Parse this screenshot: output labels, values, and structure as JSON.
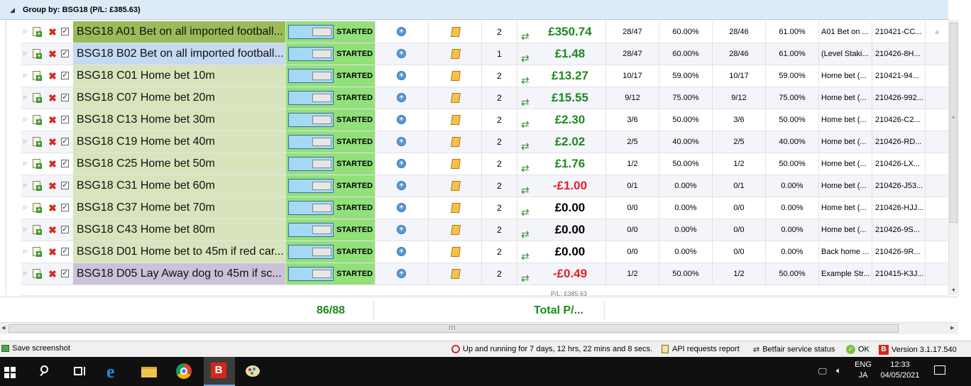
{
  "group": {
    "title": "Group by: BSG18 (P/L: £385.63)"
  },
  "rows": [
    {
      "name": "BSG18 A01 Bet on all imported football...",
      "status": "STARTED",
      "count": "2",
      "pl": "£350.74",
      "pl_class": "pos",
      "c1": "28/47",
      "c2": "60.00%",
      "c3": "28/46",
      "c4": "61.00%",
      "c5": "A01 Bet on ...",
      "c6": "210421-CC...",
      "c7": "a",
      "color": "top"
    },
    {
      "name": "BSG18 B02 Bet on all imported football...",
      "status": "STARTED",
      "count": "1",
      "pl": "£1.48",
      "pl_class": "pos",
      "c1": "28/47",
      "c2": "60.00%",
      "c3": "28/46",
      "c4": "61.00%",
      "c5": "(Level Staki...",
      "c6": "210426-8H...",
      "c7": "",
      "color": "blue"
    },
    {
      "name": "BSG18 C01 Home bet 10m",
      "status": "STARTED",
      "count": "2",
      "pl": "£13.27",
      "pl_class": "pos",
      "c1": "10/17",
      "c2": "59.00%",
      "c3": "10/17",
      "c4": "59.00%",
      "c5": "Home bet (...",
      "c6": "210421-94...",
      "c7": "",
      "color": "green"
    },
    {
      "name": "BSG18 C07 Home bet 20m",
      "status": "STARTED",
      "count": "2",
      "pl": "£15.55",
      "pl_class": "pos",
      "c1": "9/12",
      "c2": "75.00%",
      "c3": "9/12",
      "c4": "75.00%",
      "c5": "Home bet (...",
      "c6": "210426-992...",
      "c7": "",
      "color": "green"
    },
    {
      "name": "BSG18 C13 Home bet 30m",
      "status": "STARTED",
      "count": "2",
      "pl": "£2.30",
      "pl_class": "pos",
      "c1": "3/6",
      "c2": "50.00%",
      "c3": "3/6",
      "c4": "50.00%",
      "c5": "Home bet (...",
      "c6": "210426-C2...",
      "c7": "",
      "color": "green"
    },
    {
      "name": "BSG18 C19 Home bet 40m",
      "status": "STARTED",
      "count": "2",
      "pl": "£2.02",
      "pl_class": "pos",
      "c1": "2/5",
      "c2": "40.00%",
      "c3": "2/5",
      "c4": "40.00%",
      "c5": "Home bet (...",
      "c6": "210426-RD...",
      "c7": "",
      "color": "green"
    },
    {
      "name": "BSG18 C25 Home bet 50m",
      "status": "STARTED",
      "count": "2",
      "pl": "£1.76",
      "pl_class": "pos",
      "c1": "1/2",
      "c2": "50.00%",
      "c3": "1/2",
      "c4": "50.00%",
      "c5": "Home bet (...",
      "c6": "210426-LX...",
      "c7": "",
      "color": "green"
    },
    {
      "name": "BSG18 C31 Home bet 60m",
      "status": "STARTED",
      "count": "2",
      "pl": "-£1.00",
      "pl_class": "neg",
      "c1": "0/1",
      "c2": "0.00%",
      "c3": "0/1",
      "c4": "0.00%",
      "c5": "Home bet (...",
      "c6": "210426-J53...",
      "c7": "",
      "color": "green"
    },
    {
      "name": "BSG18 C37 Home bet 70m",
      "status": "STARTED",
      "count": "2",
      "pl": "£0.00",
      "pl_class": "zero",
      "c1": "0/0",
      "c2": "0.00%",
      "c3": "0/0",
      "c4": "0.00%",
      "c5": "Home bet (...",
      "c6": "210426-HJJ...",
      "c7": "",
      "color": "green"
    },
    {
      "name": "BSG18 C43 Home bet 80m",
      "status": "STARTED",
      "count": "2",
      "pl": "£0.00",
      "pl_class": "zero",
      "c1": "0/0",
      "c2": "0.00%",
      "c3": "0/0",
      "c4": "0.00%",
      "c5": "Home bet (...",
      "c6": "210426-9S...",
      "c7": "",
      "color": "green"
    },
    {
      "name": "BSG18 D01 Home bet to 45m if red car...",
      "status": "STARTED",
      "count": "2",
      "pl": "£0.00",
      "pl_class": "zero",
      "c1": "0/0",
      "c2": "0.00%",
      "c3": "0/0",
      "c4": "0.00%",
      "c5": "Back home ...",
      "c6": "210426-9R...",
      "c7": "",
      "color": "green"
    },
    {
      "name": "BSG18 D05 Lay Away dog to 45m if sc...",
      "status": "STARTED",
      "count": "2",
      "pl": "-£0.49",
      "pl_class": "neg",
      "c1": "1/2",
      "c2": "50.00%",
      "c3": "1/2",
      "c4": "50.00%",
      "c5": "Example Str...",
      "c6": "210415-K3J...",
      "c7": "",
      "color": "purple"
    }
  ],
  "summary": {
    "partial_pl": "P/L: £385.63",
    "count": "86/88",
    "total_label": "Total P/..."
  },
  "statusbar": {
    "save": "Save screenshot",
    "uptime": "Up and running for 7 days, 12 hrs, 22 mins and 8 secs.",
    "api": "API requests report",
    "betfair": "Betfair service status",
    "ok": "OK",
    "version": "Version 3.1.17.540"
  },
  "taskbar": {
    "lang1": "ENG",
    "lang2": "JA",
    "time": "12:33",
    "date": "04/05/2021"
  },
  "colors": {
    "positive": "#1e8a1e",
    "negative": "#e02020",
    "started": "#92e07a",
    "header": "#dcebf7"
  }
}
